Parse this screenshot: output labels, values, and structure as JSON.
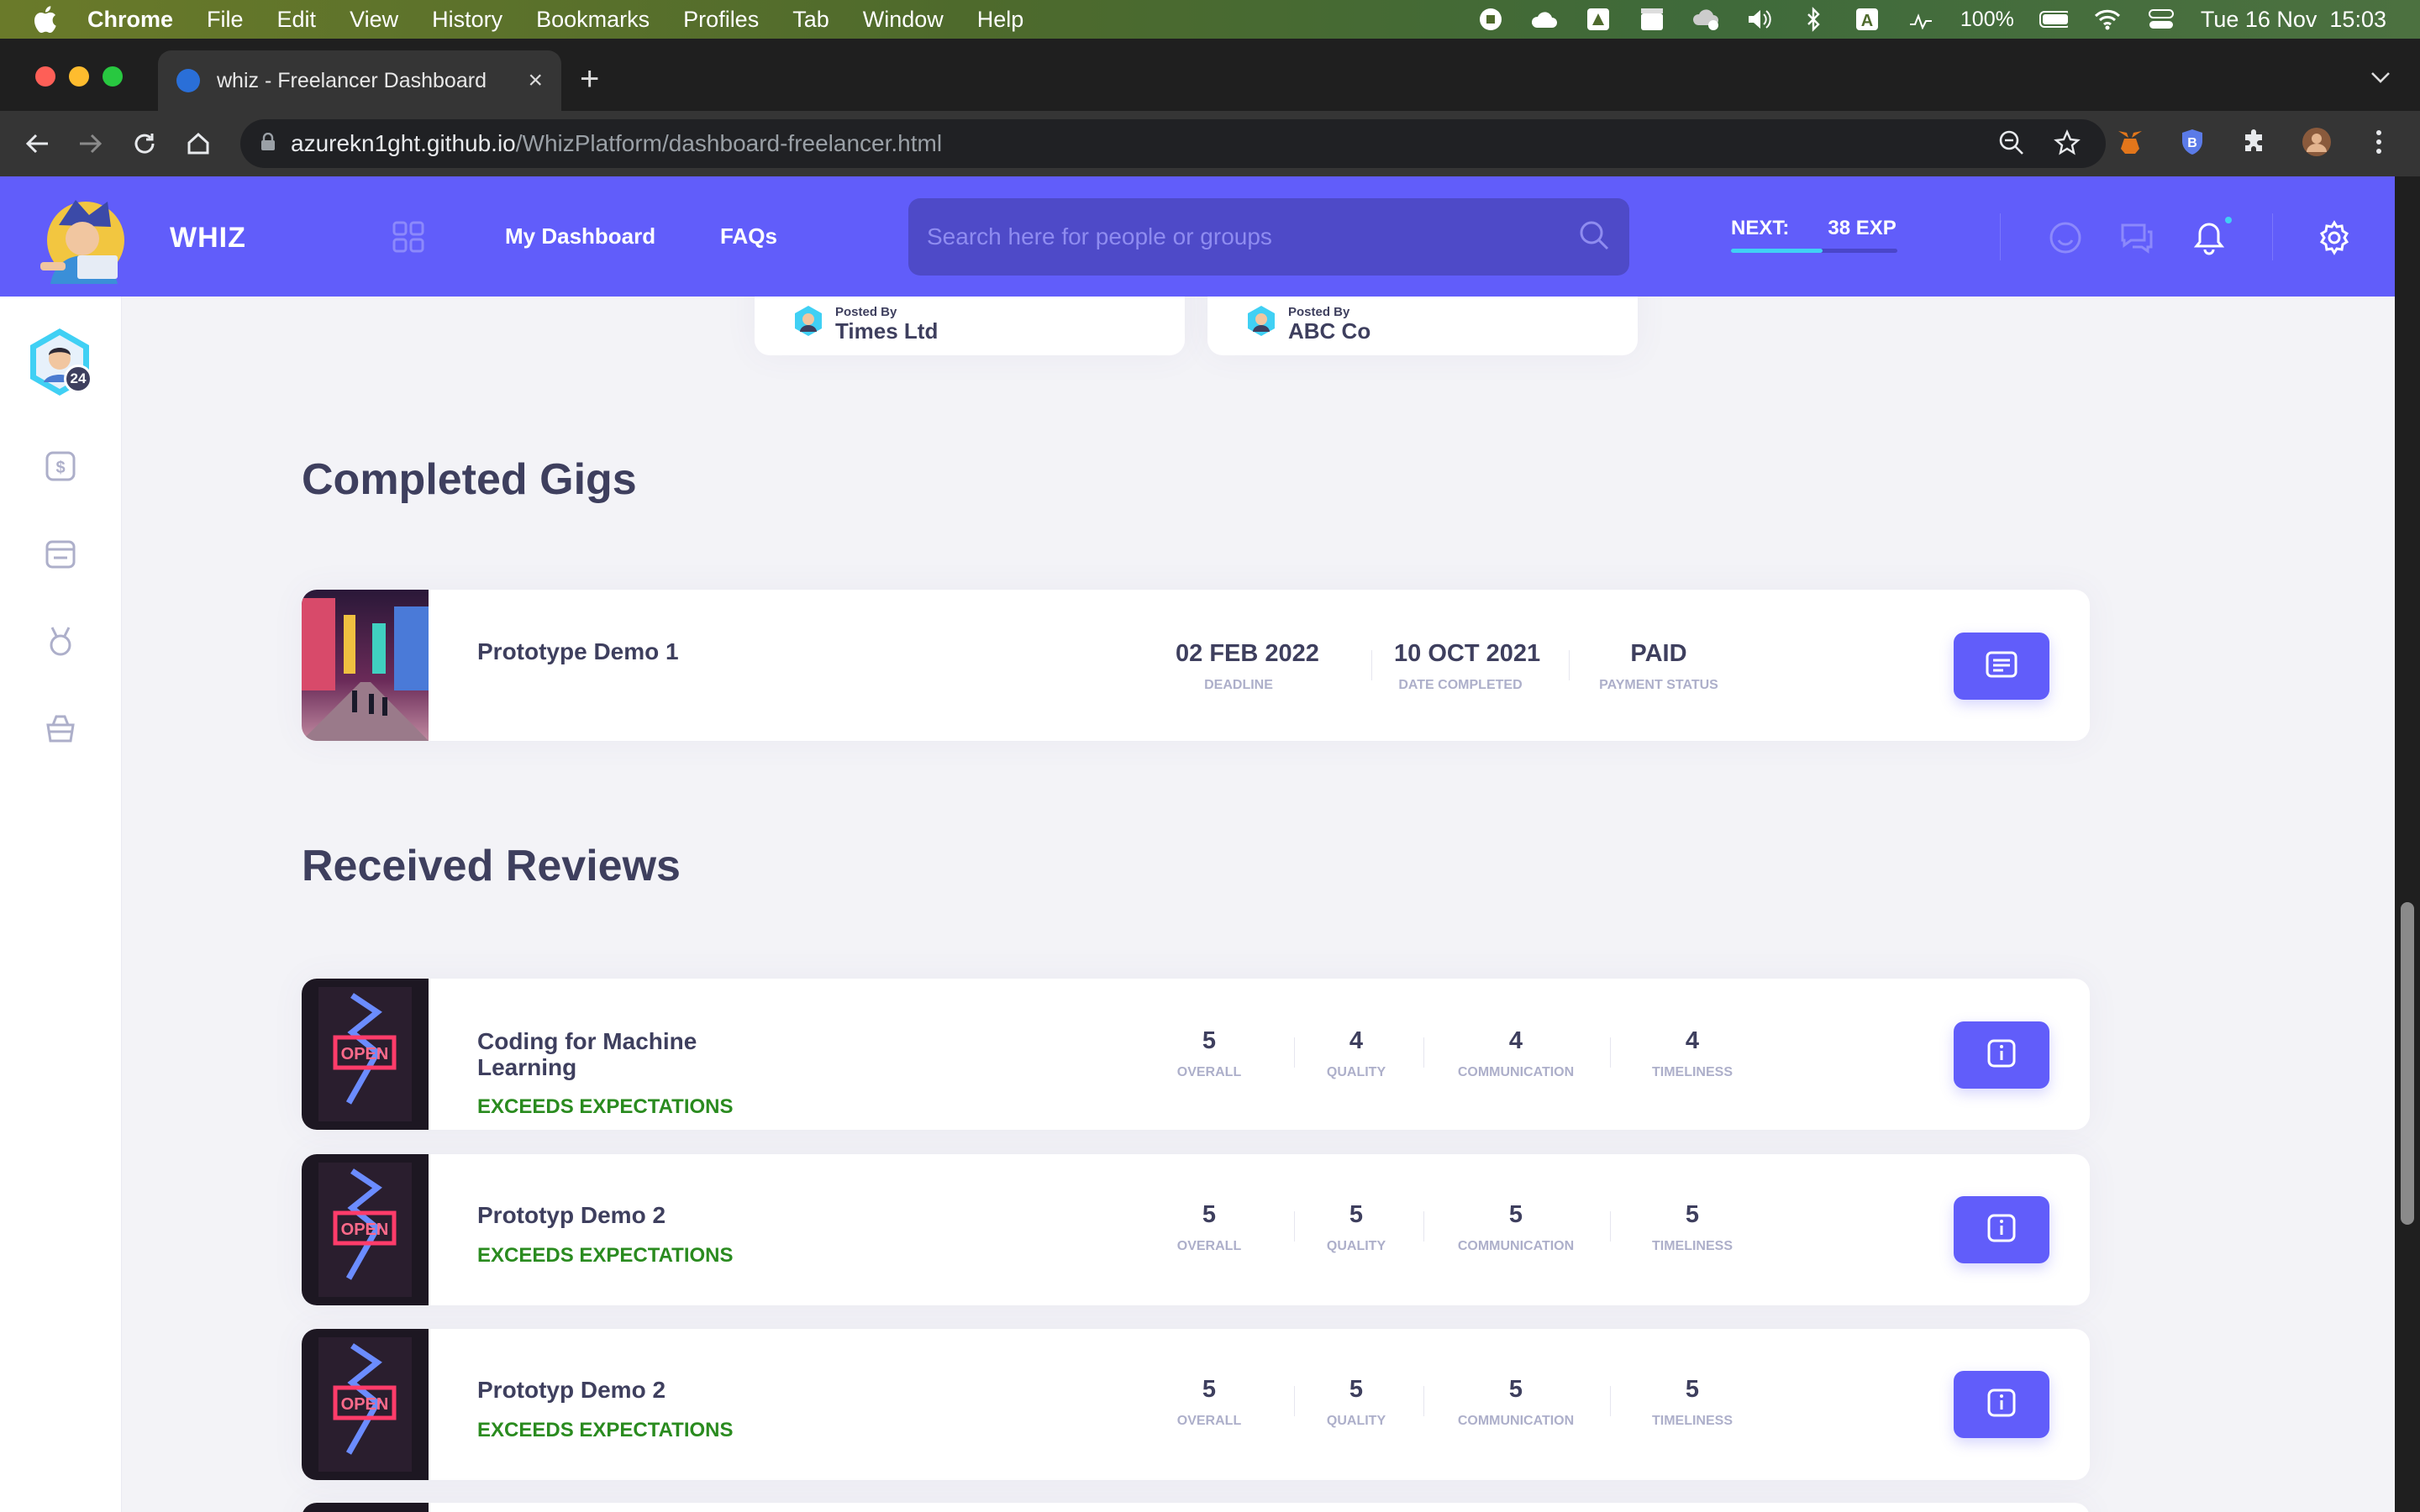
{
  "os_menubar": {
    "app": "Chrome",
    "items": [
      "File",
      "Edit",
      "View",
      "History",
      "Bookmarks",
      "Profiles",
      "Tab",
      "Window",
      "Help"
    ],
    "battery": "100%",
    "datetime": "Tue 16 Nov  15:03"
  },
  "browser": {
    "tab_title": "whiz - Freelancer Dashboard",
    "url_host": "azurekn1ght.github.io",
    "url_path": "/WhizPlatform/dashboard-freelancer.html"
  },
  "header": {
    "brand": "WHIZ",
    "nav": [
      "My Dashboard",
      "FAQs"
    ],
    "search_placeholder": "Search here for people or groups",
    "exp_label": "NEXT:",
    "exp_value": "38 EXP",
    "exp_progress": 0.55
  },
  "sidebar": {
    "level": "24"
  },
  "posted_cards": [
    {
      "posted_by_label": "Posted By",
      "company": "Times Ltd"
    },
    {
      "posted_by_label": "Posted By",
      "company": "ABC Co"
    }
  ],
  "completed_gigs": {
    "title": "Completed Gigs",
    "items": [
      {
        "name": "Prototype Demo 1",
        "deadline": "02 FEB 2022",
        "deadline_label": "DEADLINE",
        "date_completed": "10 OCT 2021",
        "date_completed_label": "DATE COMPLETED",
        "payment_status": "PAID",
        "payment_status_label": "PAYMENT STATUS"
      }
    ]
  },
  "received_reviews": {
    "title": "Received Reviews",
    "labels": {
      "overall": "OVERALL",
      "quality": "QUALITY",
      "communication": "COMMUNICATION",
      "timeliness": "TIMELINESS"
    },
    "items": [
      {
        "name": "Coding for Machine Learning",
        "badge": "EXCEEDS EXPECTATIONS",
        "overall": "5",
        "quality": "4",
        "communication": "4",
        "timeliness": "4"
      },
      {
        "name": "Prototyp Demo 2",
        "badge": "EXCEEDS EXPECTATIONS",
        "overall": "5",
        "quality": "5",
        "communication": "5",
        "timeliness": "5"
      },
      {
        "name": "Prototyp Demo 2",
        "badge": "EXCEEDS EXPECTATIONS",
        "overall": "5",
        "quality": "5",
        "communication": "5",
        "timeliness": "5"
      }
    ]
  },
  "colors": {
    "primary": "#615dfa",
    "text": "#3e3f5e",
    "muted": "#adafca",
    "success": "#2a8b1f"
  }
}
